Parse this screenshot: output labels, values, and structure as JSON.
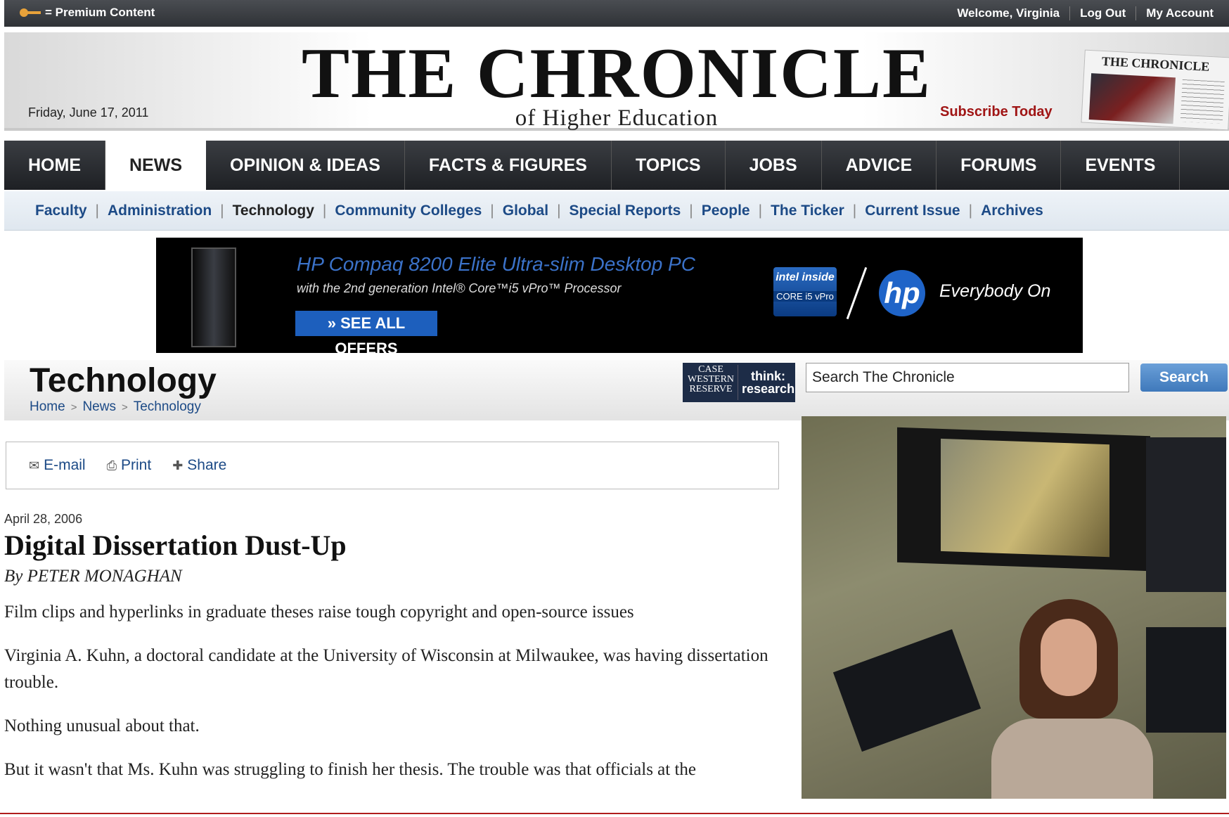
{
  "topbar": {
    "premium_label": "= Premium Content",
    "welcome": "Welcome, Virginia",
    "logout": "Log Out",
    "account": "My Account"
  },
  "masthead": {
    "title": "THE CHRONICLE",
    "subtitle": "of Higher Education",
    "date": "Friday, June 17, 2011",
    "subscribe": "Subscribe Today",
    "paper_thumb_title": "THE CHRONICLE"
  },
  "mainnav": [
    {
      "label": "HOME",
      "active": false
    },
    {
      "label": "NEWS",
      "active": true
    },
    {
      "label": "OPINION & IDEAS",
      "active": false
    },
    {
      "label": "FACTS & FIGURES",
      "active": false
    },
    {
      "label": "TOPICS",
      "active": false
    },
    {
      "label": "JOBS",
      "active": false
    },
    {
      "label": "ADVICE",
      "active": false
    },
    {
      "label": "FORUMS",
      "active": false
    },
    {
      "label": "EVENTS",
      "active": false
    }
  ],
  "subnav": [
    "Faculty",
    "Administration",
    "Technology",
    "Community Colleges",
    "Global",
    "Special Reports",
    "People",
    "The Ticker",
    "Current Issue",
    "Archives"
  ],
  "subnav_current": "Technology",
  "ad": {
    "headline": "HP Compaq 8200 Elite Ultra-slim Desktop PC",
    "sub": "with the 2nd generation Intel® Core™i5 vPro™ Processor",
    "cta": "» SEE ALL OFFERS",
    "intel_logo": "intel inside",
    "intel_core": "CORE i5 vPro",
    "hp_logo": "hp",
    "tagline": "Everybody On"
  },
  "section": {
    "title": "Technology",
    "breadcrumb": [
      "Home",
      "News",
      "Technology"
    ]
  },
  "sponsor": {
    "left": "CASE WESTERN RESERVE",
    "right_top": "think:",
    "right_bottom": "research"
  },
  "search": {
    "value": "Search The Chronicle",
    "button": "Search"
  },
  "tools": {
    "email": "E-mail",
    "print": "Print",
    "share": "Share"
  },
  "article": {
    "date": "April 28, 2006",
    "title": "Digital Dissertation Dust-Up",
    "byline": "By PETER MONAGHAN",
    "dek": "Film clips and hyperlinks in graduate theses raise tough copyright and open-source issues",
    "p1": "Virginia A. Kuhn, a doctoral candidate at the University of Wisconsin at Milwaukee, was having dissertation trouble.",
    "p2": "Nothing unusual about that.",
    "p3": "But it wasn't that Ms. Kuhn was struggling to finish her thesis. The trouble was that officials at the"
  },
  "colors": {
    "link": "#1c4a86",
    "subscribe": "#a01515",
    "ad_blue": "#1d5fbd",
    "nav_dark": "#1e2024"
  }
}
